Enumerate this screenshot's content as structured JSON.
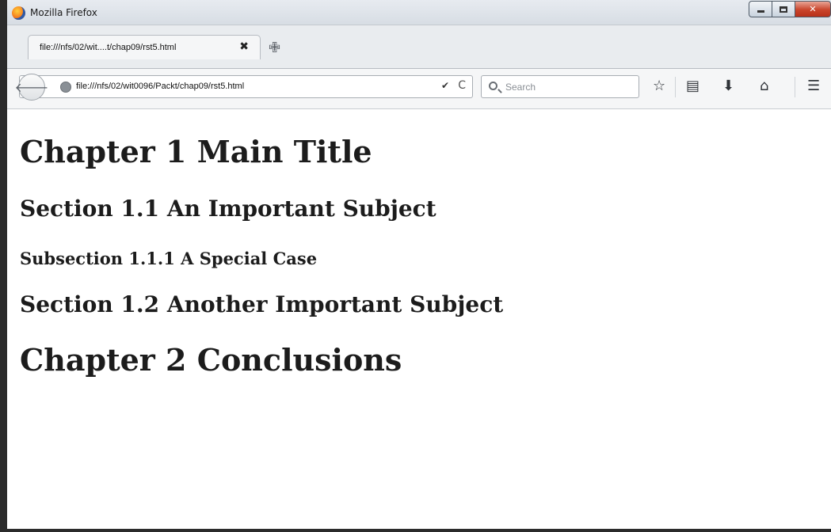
{
  "window": {
    "title": "Mozilla Firefox"
  },
  "tabs": [
    {
      "label": "file:///nfs/02/wit....t/chap09/rst5.html",
      "close_glyph": "✖"
    }
  ],
  "newtab_glyph": "✙",
  "navbar": {
    "back_glyph": "🡐",
    "url": "file:///nfs/02/wit0096/Packt/chap09/rst5.html",
    "dropdown_glyph": "✔",
    "reload_glyph": "C",
    "search_placeholder": "Search",
    "icons": [
      "star-icon",
      "reading-list-icon",
      "download-icon",
      "home-icon",
      "menu-icon"
    ]
  },
  "page": {
    "headings": [
      {
        "level": "h1",
        "text": "Chapter 1 Main Title"
      },
      {
        "level": "h2",
        "text": "Section 1.1 An Important Subject"
      },
      {
        "level": "h3",
        "text": "Subsection 1.1.1 A Special Case"
      },
      {
        "level": "h2",
        "text": "Section 1.2 Another Important Subject"
      },
      {
        "level": "h1",
        "text": "Chapter 2 Conclusions"
      }
    ]
  }
}
